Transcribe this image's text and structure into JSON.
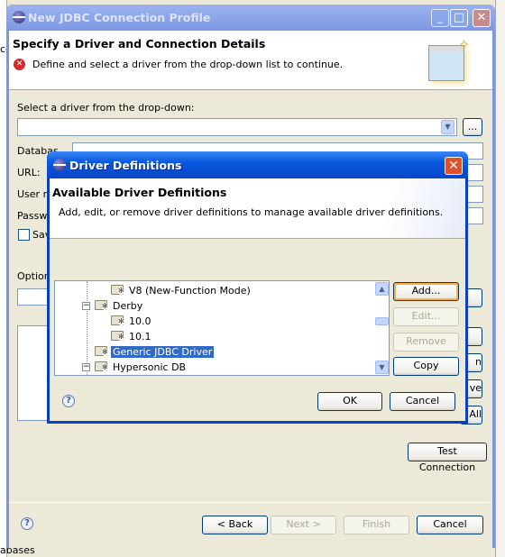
{
  "background": {
    "left_text": "ce",
    "bottom_text": "abases"
  },
  "wizard": {
    "title": "New JDBC Connection Profile",
    "window_buttons": {
      "minimize": "_",
      "maximize": "□",
      "close": "✕"
    },
    "header": {
      "title": "Specify a Driver and Connection Details",
      "message": "Define and select a driver from the drop-down list to continue.",
      "message_icon": "error-icon"
    },
    "driver_label": "Select a driver from the drop-down:",
    "driver_value": "",
    "browse_label": "...",
    "fields": {
      "database": "Databas",
      "url": "URL:",
      "user": "User n",
      "password": "Passw",
      "save": "Sav"
    },
    "optional_label": "Option",
    "side_buttons": [
      "",
      "",
      "n",
      "ve",
      "All"
    ],
    "test_connection": "Test Connection",
    "back": "< Back",
    "next": "Next >",
    "finish": "Finish",
    "cancel": "Cancel"
  },
  "dialog": {
    "title": "Driver Definitions",
    "close": "✕",
    "header_title": "Available Driver Definitions",
    "header_desc": "Add, edit, or remove driver definitions to manage available driver definitions.",
    "tree": [
      {
        "label": "V8 (New-Function Mode)",
        "level": 2
      },
      {
        "label": "Derby",
        "level": 1,
        "expanded": true
      },
      {
        "label": "10.0",
        "level": 2
      },
      {
        "label": "10.1",
        "level": 2
      },
      {
        "label": "Generic JDBC Driver",
        "level": 1,
        "selected": true
      },
      {
        "label": "Hypersonic DB",
        "level": 1,
        "expanded": true
      }
    ],
    "buttons": {
      "add": "Add...",
      "edit": "Edit...",
      "remove": "Remove",
      "copy": "Copy"
    },
    "ok": "OK",
    "cancel": "Cancel"
  },
  "colors": {
    "selection": "#316ac5",
    "dialog_titlebar": "#0a58e0",
    "inactive_titlebar": "#7d98e3"
  }
}
